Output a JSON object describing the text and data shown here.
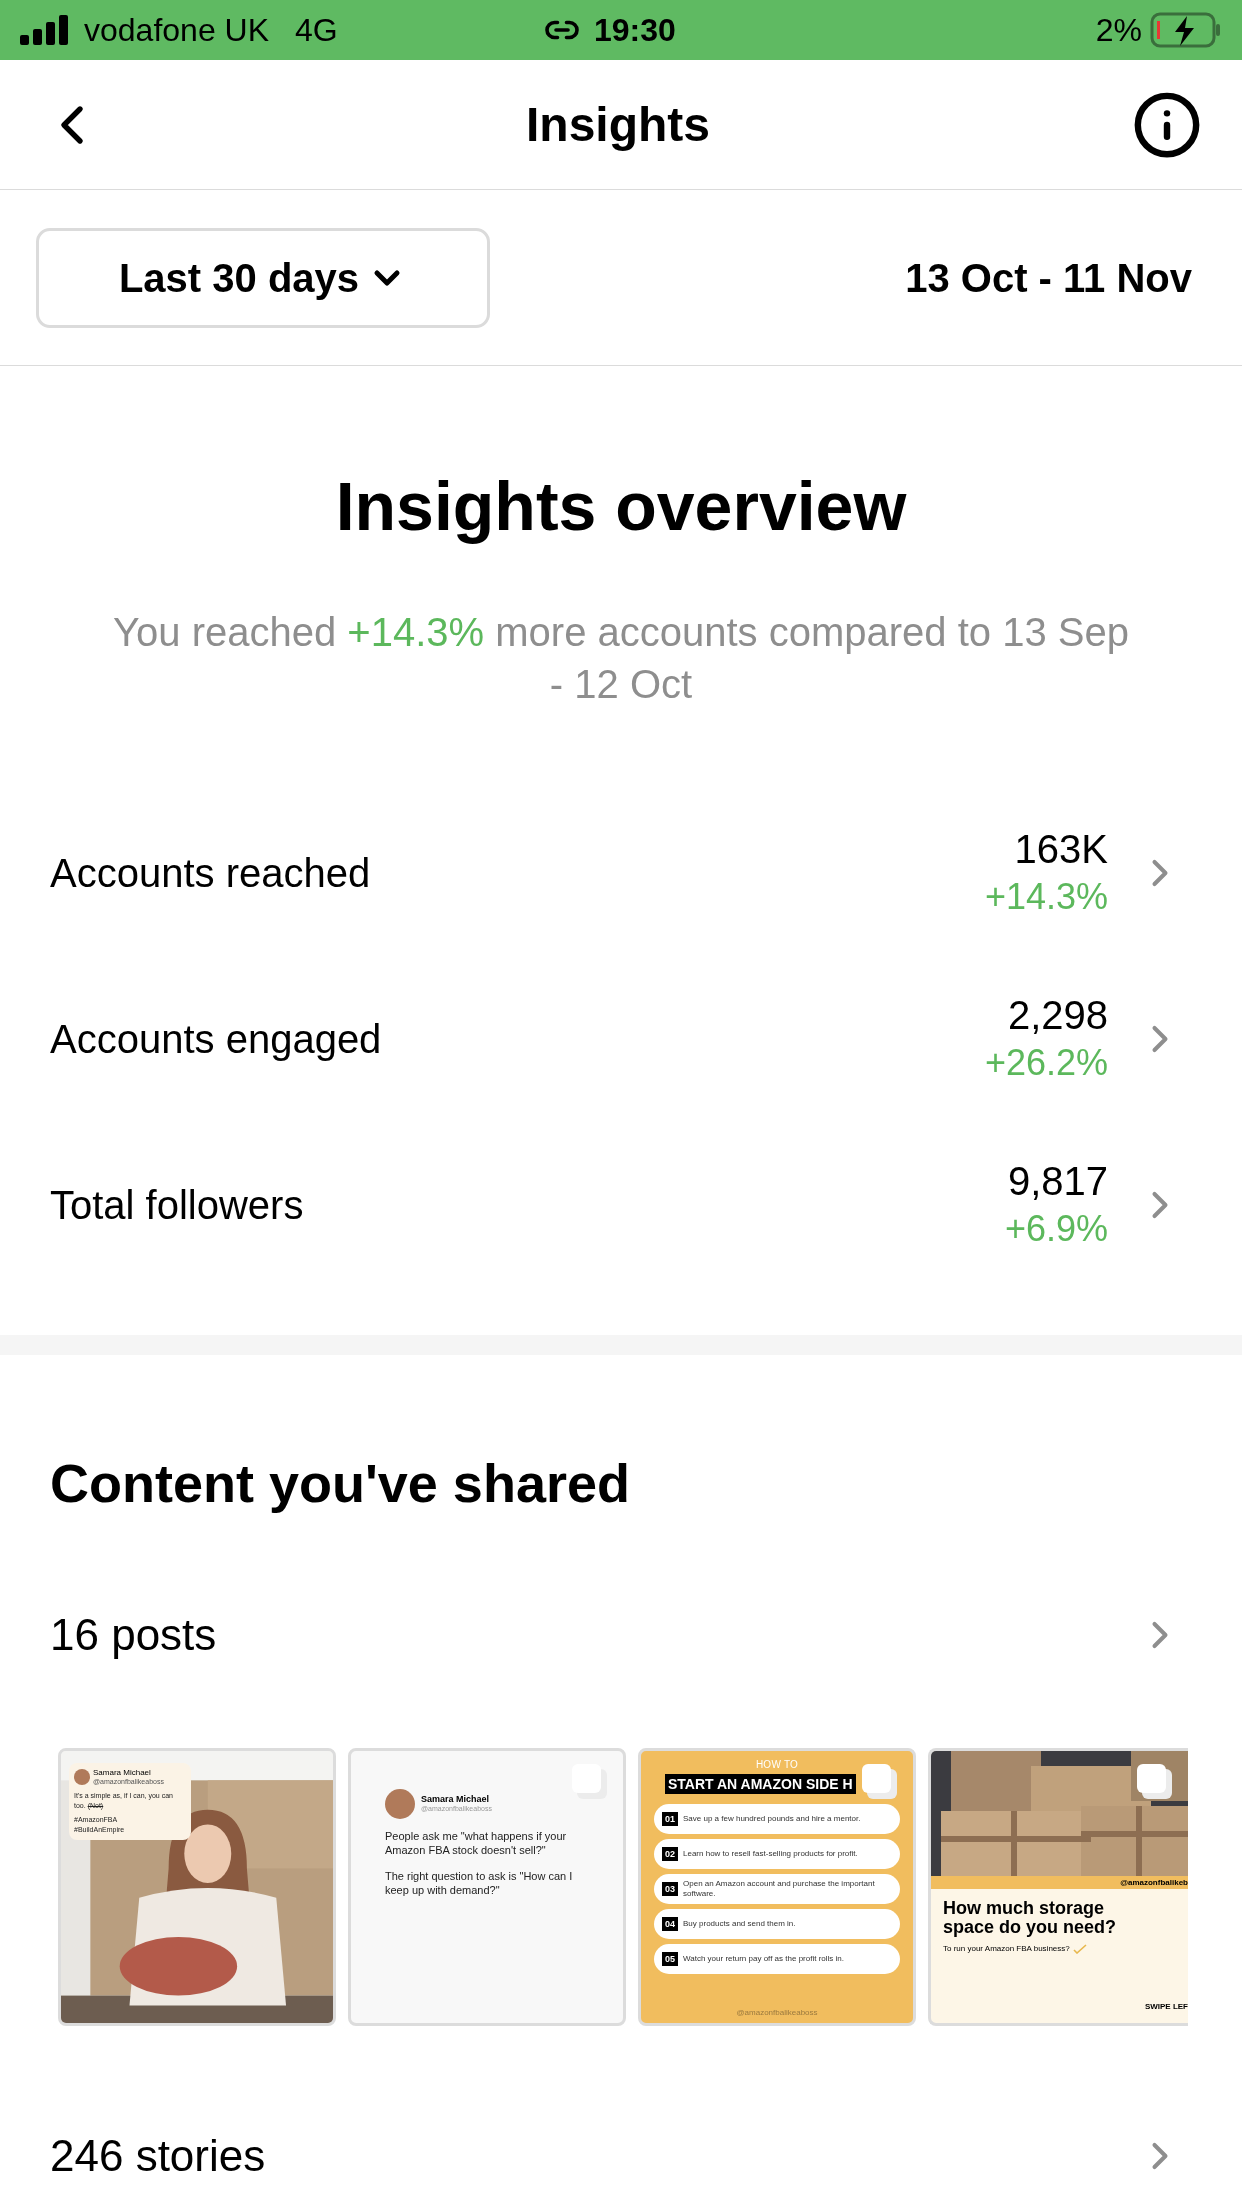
{
  "status_bar": {
    "carrier": "vodafone UK",
    "network": "4G",
    "time": "19:30",
    "battery": "2%"
  },
  "header": {
    "title": "Insights"
  },
  "period": {
    "label": "Last 30 days",
    "range": "13 Oct - 11 Nov"
  },
  "overview": {
    "title": "Insights overview",
    "summary_prefix": "You reached ",
    "summary_change": "+14.3%",
    "summary_suffix": " more accounts compared to 13 Sep - 12 Oct"
  },
  "metrics": [
    {
      "label": "Accounts reached",
      "value": "163K",
      "change": "+14.3%"
    },
    {
      "label": "Accounts engaged",
      "value": "2,298",
      "change": "+26.2%"
    },
    {
      "label": "Total followers",
      "value": "9,817",
      "change": "+6.9%"
    }
  ],
  "content": {
    "title": "Content you've shared",
    "posts": {
      "label": "16 posts",
      "thumbnails": [
        {
          "kind": "photo_card",
          "carousel": false,
          "author": "Samara Michael",
          "handle": "@amazonfbalikeaboss",
          "text": "It's a simple as, if I can, you can too.",
          "aside": "(Not)",
          "tags": [
            "#AmazonFBA",
            "#BuildAnEmpire"
          ]
        },
        {
          "kind": "text_post",
          "carousel": true,
          "author": "Samara Michael",
          "handle": "@amazonfbalikeaboss",
          "paragraphs": [
            "People ask me \"what happens if your Amazon FBA stock doesn't sell?\"",
            "The right question to ask is \"How can I keep up with demand?\""
          ]
        },
        {
          "kind": "steps",
          "carousel": true,
          "kicker": "HOW TO",
          "title": "START AN AMAZON SIDE H",
          "steps": [
            {
              "number": "01",
              "text": "Save up a few hundred pounds and hire a mentor."
            },
            {
              "number": "02",
              "text": "Learn how to resell fast-selling products for profit."
            },
            {
              "number": "03",
              "text": "Open an Amazon account and purchase the important software."
            },
            {
              "number": "04",
              "text": "Buy products and send them in."
            },
            {
              "number": "05",
              "text": "Watch your return pay off as the profit rolls in."
            }
          ],
          "handle": "@amazonfbalikeaboss"
        },
        {
          "kind": "photo_promo",
          "carousel": true,
          "handle": "@amazonfbalikeb",
          "headline": "How much storage space do you need?",
          "subline": "To run your Amazon FBA business?",
          "cta": "SWIPE LEF"
        }
      ]
    },
    "stories": {
      "label": "246 stories"
    }
  }
}
